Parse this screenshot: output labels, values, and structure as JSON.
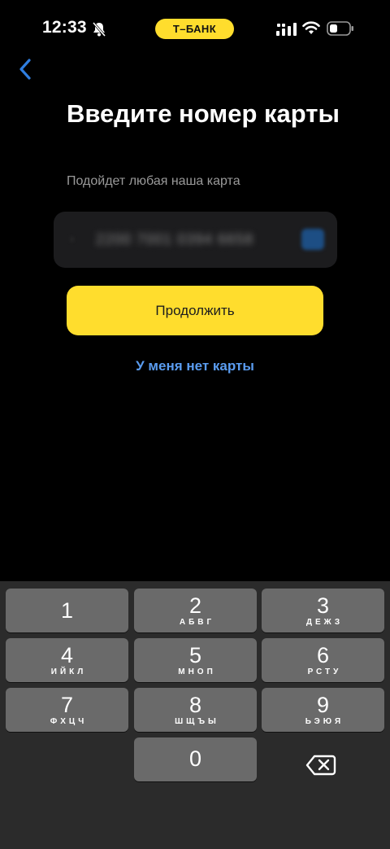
{
  "status_bar": {
    "time": "12:33",
    "carrier_pill": "Т–БАНК",
    "icons": [
      "bell-slash-icon",
      "cellular-signal-icon",
      "wifi-icon",
      "battery-icon"
    ]
  },
  "colors": {
    "background": "#000000",
    "accent_yellow": "#ffdd2d",
    "link_blue": "#5a9cf0",
    "field_bg": "#1c1c1e",
    "key_bg": "#6a6a6a",
    "keypad_bg": "#2b2b2b"
  },
  "header": {
    "back_icon": "chevron-left-icon",
    "title": "Введите номер карты",
    "subtitle": "Подойдет любая наша карта"
  },
  "card_input": {
    "prefix": "›",
    "value": "2200 7001 0394 6658",
    "obscured": true,
    "scan_icon": "card-scan-icon"
  },
  "actions": {
    "continue_label": "Продолжить",
    "no_card_link": "У меня нет карты"
  },
  "keypad": {
    "keys": [
      {
        "digit": "1",
        "letters": ""
      },
      {
        "digit": "2",
        "letters": "АБВГ"
      },
      {
        "digit": "3",
        "letters": "ДЕЖЗ"
      },
      {
        "digit": "4",
        "letters": "ИЙКЛ"
      },
      {
        "digit": "5",
        "letters": "МНОП"
      },
      {
        "digit": "6",
        "letters": "РСТУ"
      },
      {
        "digit": "7",
        "letters": "ФХЦЧ"
      },
      {
        "digit": "8",
        "letters": "ШЩЪЫ"
      },
      {
        "digit": "9",
        "letters": "ЬЭЮЯ"
      },
      {
        "digit": "0",
        "letters": ""
      }
    ],
    "delete_icon": "backspace-icon"
  }
}
